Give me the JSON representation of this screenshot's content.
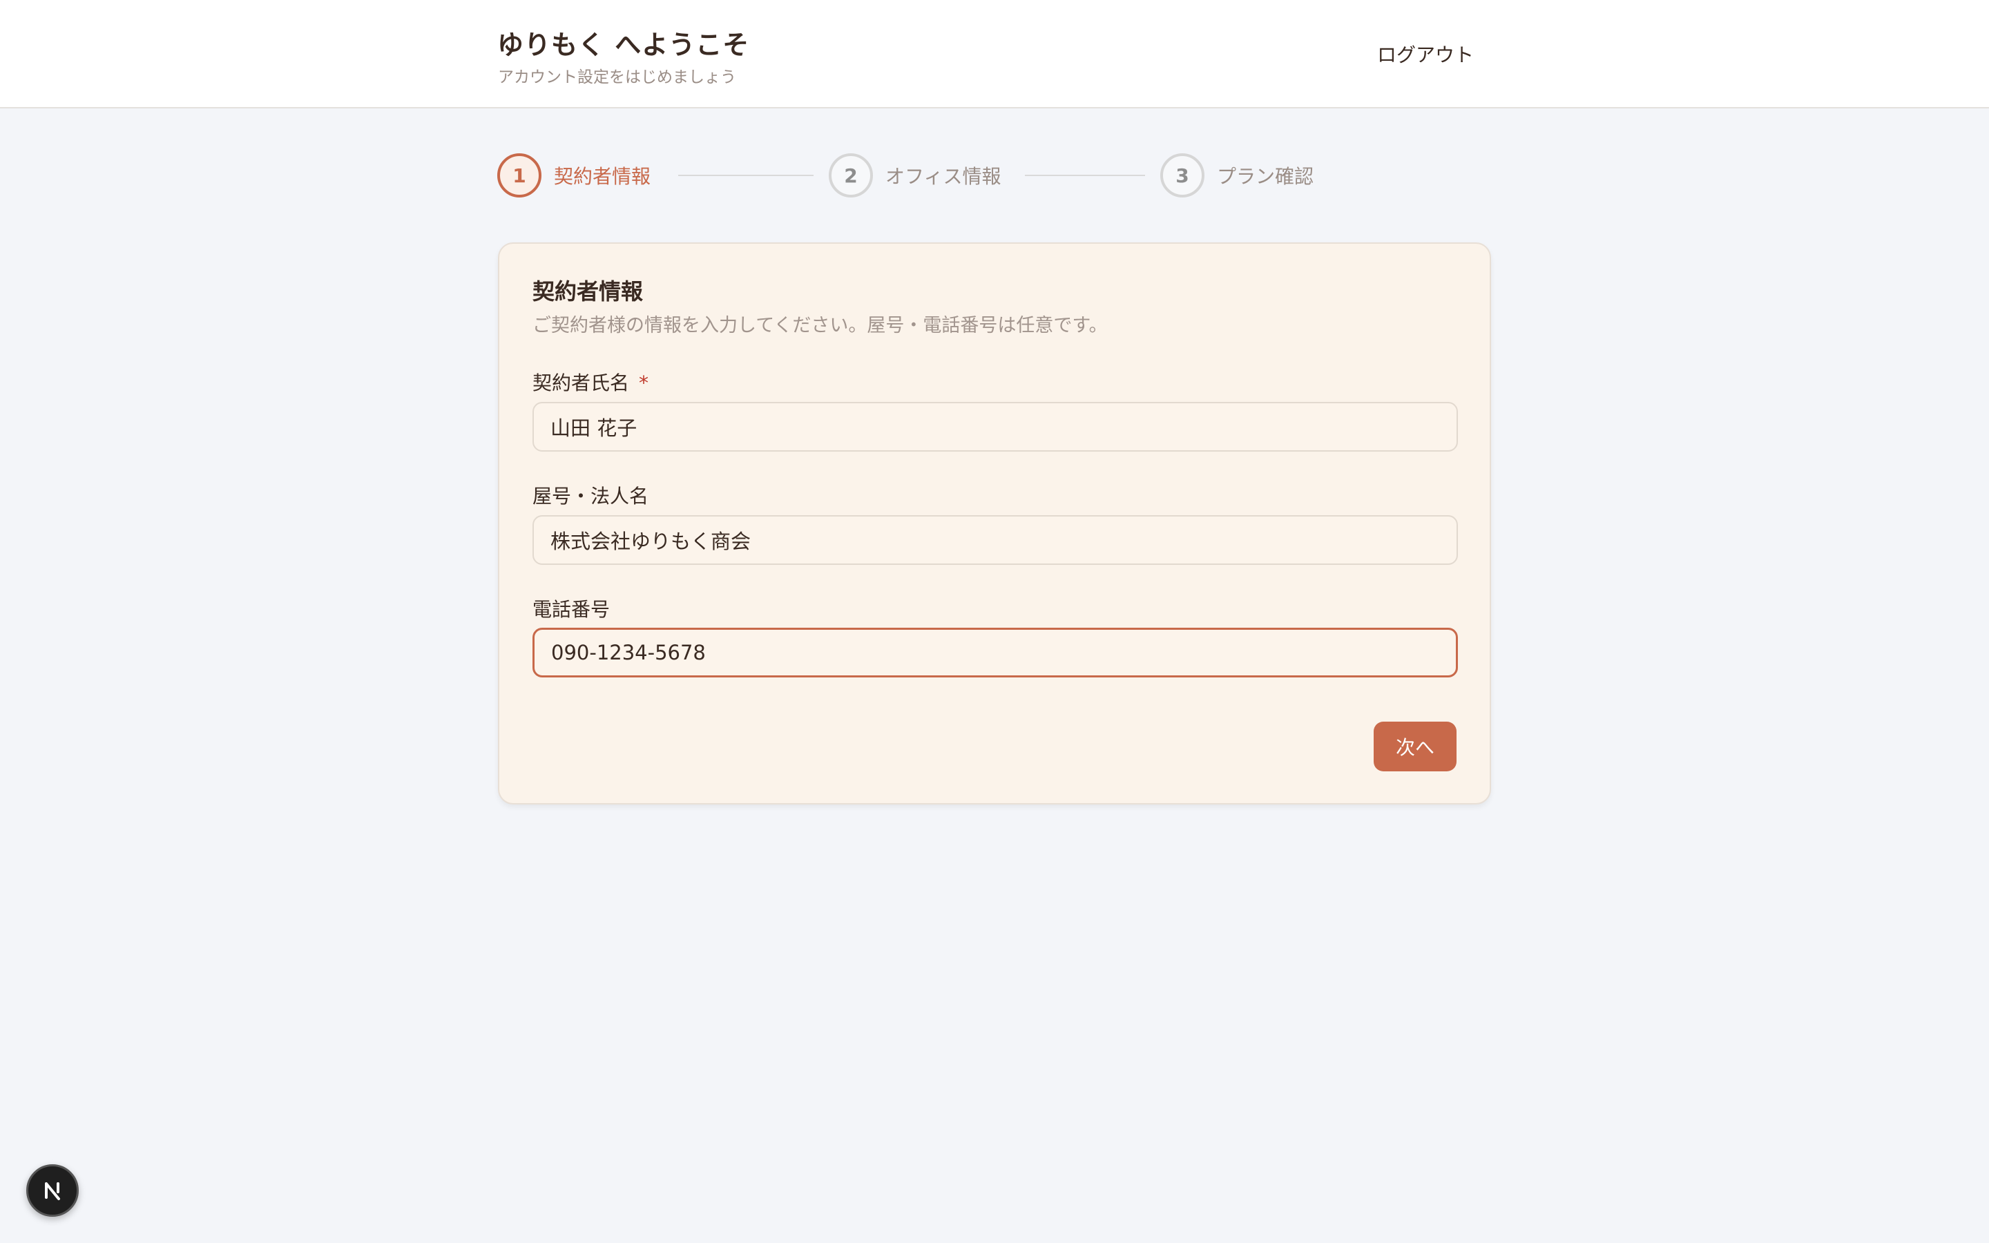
{
  "header": {
    "title": "ゆりもく へようこそ",
    "subtitle": "アカウント設定をはじめましょう",
    "logout_label": "ログアウト"
  },
  "stepper": {
    "steps": [
      {
        "number": "1",
        "label": "契約者情報",
        "state": "active"
      },
      {
        "number": "2",
        "label": "オフィス情報",
        "state": "inactive"
      },
      {
        "number": "3",
        "label": "プラン確認",
        "state": "inactive"
      }
    ]
  },
  "form": {
    "title": "契約者情報",
    "description": "ご契約者様の情報を入力してください。屋号・電話番号は任意です。",
    "fields": [
      {
        "label": "契約者氏名",
        "required_mark": "*",
        "value": "山田 花子"
      },
      {
        "label": "屋号・法人名",
        "value": "株式会社ゆりもく商会"
      },
      {
        "label": "電話番号",
        "value": "090-1234-5678"
      }
    ],
    "next_label": "次へ"
  },
  "dev_badge": {
    "icon": "nextjs-n-icon"
  },
  "colors": {
    "accent": "#c8694a",
    "card_bg": "#fbf3ea",
    "page_bg": "#f3f5f9",
    "required": "#c0392b"
  }
}
